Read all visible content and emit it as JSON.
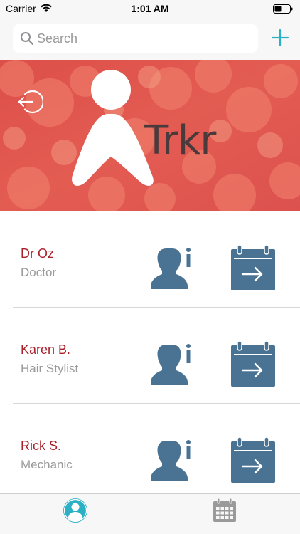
{
  "status_bar": {
    "carrier": "Carrier",
    "time": "1:01 AM"
  },
  "search": {
    "placeholder": "Search"
  },
  "banner": {
    "logo_text": "Trkr",
    "color": "#e0584f"
  },
  "contacts": [
    {
      "name": "Dr Oz",
      "role": "Doctor"
    },
    {
      "name": "Karen B.",
      "role": "Hair Stylist"
    },
    {
      "name": "Rick S.",
      "role": "Mechanic"
    }
  ],
  "colors": {
    "accent": "#2bb0c4",
    "name": "#a8222c",
    "icon": "#4a7393",
    "inactive_tab": "#9a9a9a"
  },
  "icons": {
    "add": "plus-icon",
    "back": "back-arrow-icon",
    "info": "person-info-icon",
    "calendar": "calendar-arrow-icon",
    "tab_contacts": "person-icon",
    "tab_calendar": "calendar-grid-icon"
  }
}
